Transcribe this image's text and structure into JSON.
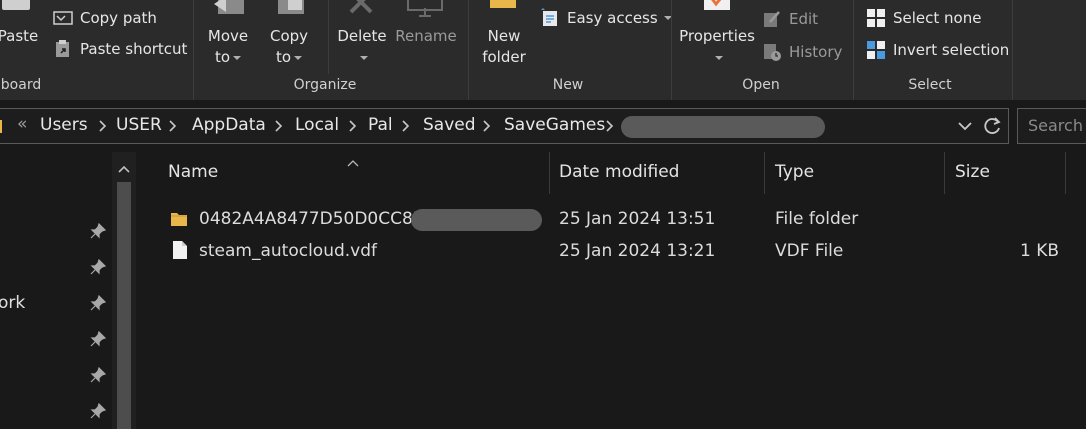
{
  "ribbon": {
    "clipboard": {
      "group_label": "board",
      "paste_label": "Paste",
      "copy_path_label": "Copy path",
      "paste_shortcut_label": "Paste shortcut"
    },
    "organize": {
      "group_label": "Organize",
      "move_to_line1": "Move",
      "move_to_line2": "to",
      "copy_to_line1": "Copy",
      "copy_to_line2": "to",
      "delete_label": "Delete",
      "rename_label": "Rename"
    },
    "new": {
      "group_label": "New",
      "new_folder_line1": "New",
      "new_folder_line2": "folder",
      "easy_access_label": "Easy access"
    },
    "open": {
      "group_label": "Open",
      "properties_label": "Properties",
      "edit_label": "Edit",
      "history_label": "History"
    },
    "select": {
      "group_label": "Select",
      "select_none_label": "Select none",
      "invert_selection_label": "Invert selection"
    }
  },
  "address": {
    "overflow": "«",
    "crumbs": [
      "Users",
      "USER",
      "AppData",
      "Local",
      "Pal",
      "Saved",
      "SaveGames"
    ],
    "search_placeholder": "Search"
  },
  "nav": {
    "visible_label": "ork"
  },
  "columns": {
    "name": "Name",
    "date_modified": "Date modified",
    "type": "Type",
    "size": "Size"
  },
  "files": [
    {
      "name": "0482A4A8477D50D0CC8D",
      "date_modified": "25 Jan 2024 13:51",
      "type": "File folder",
      "size": "",
      "icon": "folder-icon"
    },
    {
      "name": "steam_autocloud.vdf",
      "date_modified": "25 Jan 2024 13:21",
      "type": "VDF File",
      "size": "1 KB",
      "icon": "file-icon"
    }
  ],
  "colors": {
    "ribbon_bg": "#2b2b2b",
    "window_bg": "#191919",
    "folder_yellow": "#e8b64a",
    "accent_blue": "#4a9ae0",
    "properties_orange": "#e8743b"
  }
}
